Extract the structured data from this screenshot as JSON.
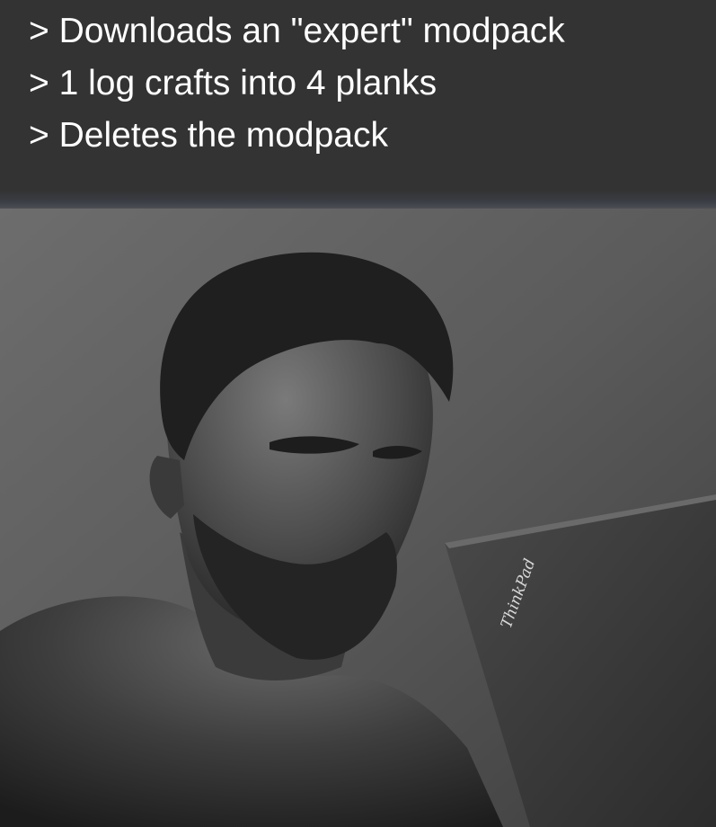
{
  "caption": {
    "lines": [
      "> Downloads an \"expert\" modpack",
      "> 1 log crafts into 4 planks",
      "> Deletes the modpack"
    ]
  },
  "photo": {
    "subject": "bearded man looking at laptop",
    "laptop_logo": "ThinkPad",
    "palette": "grayscale"
  }
}
